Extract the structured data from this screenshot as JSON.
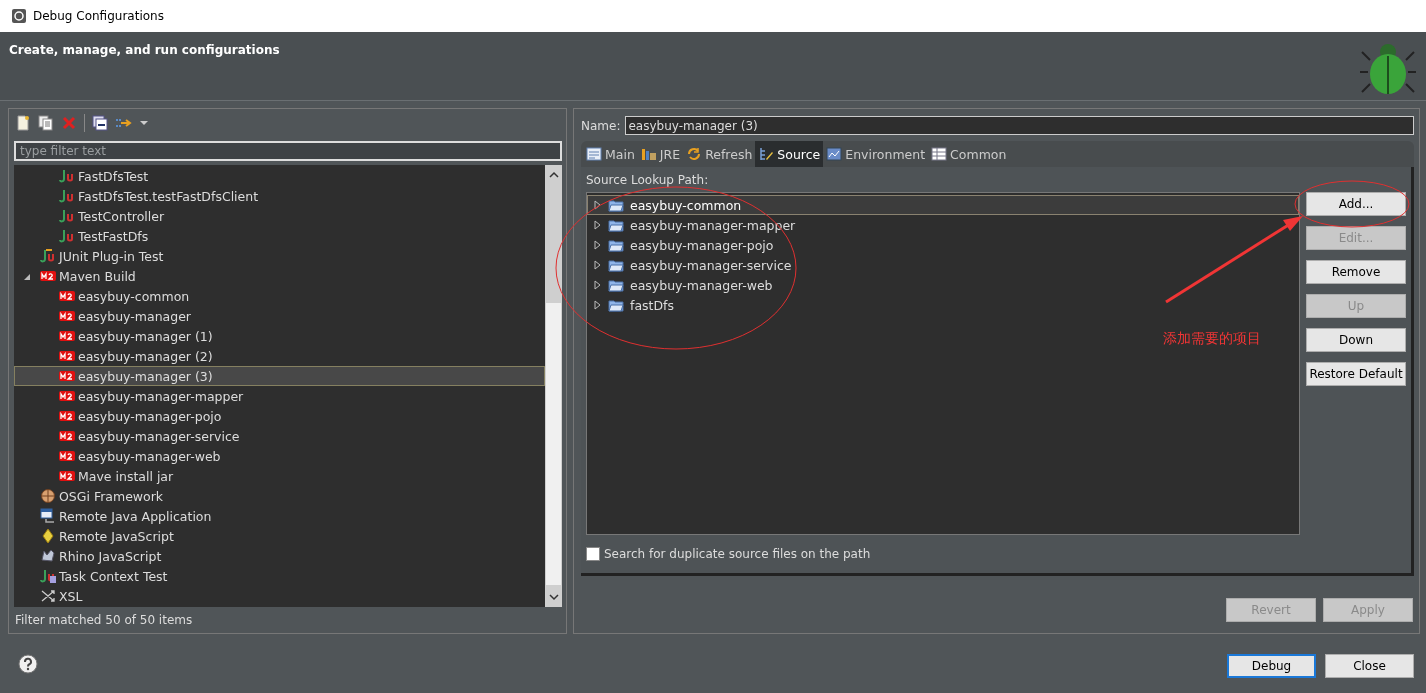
{
  "window": {
    "title": "Debug Configurations"
  },
  "header": {
    "title": "Create, manage, and run configurations"
  },
  "sidebar": {
    "filter": {
      "placeholder": "type filter text"
    },
    "tree": {
      "continued_children": [
        {
          "label": "FastDfsTest",
          "kind": "junit",
          "selected": false
        },
        {
          "label": "FastDfsTest.testFastDfsClient",
          "kind": "junit",
          "selected": false
        },
        {
          "label": "TestController",
          "kind": "junit",
          "selected": false
        },
        {
          "label": "TestFastDfs",
          "kind": "junit",
          "selected": false
        }
      ],
      "items": [
        {
          "label": "JUnit Plug-in Test",
          "kind": "junit-plugin",
          "selected": false
        },
        {
          "label": "Maven Build",
          "kind": "maven",
          "selected": false,
          "expanded": true,
          "children": [
            {
              "label": "easybuy-common",
              "kind": "maven",
              "selected": false
            },
            {
              "label": "easybuy-manager",
              "kind": "maven",
              "selected": false
            },
            {
              "label": "easybuy-manager (1)",
              "kind": "maven",
              "selected": false
            },
            {
              "label": "easybuy-manager (2)",
              "kind": "maven",
              "selected": false
            },
            {
              "label": "easybuy-manager (3)",
              "kind": "maven",
              "selected": true
            },
            {
              "label": "easybuy-manager-mapper",
              "kind": "maven",
              "selected": false
            },
            {
              "label": "easybuy-manager-pojo",
              "kind": "maven",
              "selected": false
            },
            {
              "label": "easybuy-manager-service",
              "kind": "maven",
              "selected": false
            },
            {
              "label": "easybuy-manager-web",
              "kind": "maven",
              "selected": false
            },
            {
              "label": "Mave install jar",
              "kind": "maven",
              "selected": false
            }
          ]
        },
        {
          "label": "OSGi Framework",
          "kind": "osgi",
          "selected": false
        },
        {
          "label": "Remote Java Application",
          "kind": "remote-java",
          "selected": false
        },
        {
          "label": "Remote JavaScript",
          "kind": "remote-js",
          "selected": false
        },
        {
          "label": "Rhino JavaScript",
          "kind": "rhino",
          "selected": false
        },
        {
          "label": "Task Context Test",
          "kind": "task-context",
          "selected": false
        },
        {
          "label": "XSL",
          "kind": "xsl",
          "selected": false
        }
      ]
    },
    "status": "Filter matched 50 of 50 items"
  },
  "editor": {
    "name_label": "Name:",
    "name": "easybuy-manager (3)",
    "tabs": [
      {
        "label": "Main",
        "kind": "main",
        "selected": false
      },
      {
        "label": "JRE",
        "kind": "jre",
        "selected": false
      },
      {
        "label": "Refresh",
        "kind": "refresh",
        "selected": false
      },
      {
        "label": "Source",
        "kind": "source",
        "selected": true
      },
      {
        "label": "Environment",
        "kind": "environment",
        "selected": false
      },
      {
        "label": "Common",
        "kind": "common",
        "selected": false
      }
    ],
    "source": {
      "label": "Source Lookup Path:",
      "items": [
        {
          "label": "easybuy-common",
          "selected": true,
          "expanded": false
        },
        {
          "label": "easybuy-manager-mapper",
          "selected": false,
          "expanded": false
        },
        {
          "label": "easybuy-manager-pojo",
          "selected": false,
          "expanded": false
        },
        {
          "label": "easybuy-manager-service",
          "selected": false,
          "expanded": false
        },
        {
          "label": "easybuy-manager-web",
          "selected": false,
          "expanded": false
        },
        {
          "label": "fastDfs",
          "selected": false,
          "expanded": false
        }
      ],
      "buttons": [
        {
          "label": "Add...",
          "disabled": false
        },
        {
          "label": "Edit...",
          "disabled": true
        },
        {
          "label": "Remove",
          "disabled": false
        },
        {
          "label": "Up",
          "disabled": true
        },
        {
          "label": "Down",
          "disabled": false
        },
        {
          "label": "Restore Default",
          "disabled": false
        }
      ],
      "duplicate_check": {
        "label": "Search for duplicate source files on the path",
        "checked": false
      }
    },
    "actions": [
      {
        "label": "Revert",
        "disabled": true
      },
      {
        "label": "Apply",
        "disabled": true
      }
    ]
  },
  "footer": {
    "buttons": [
      {
        "label": "Debug",
        "default": true
      },
      {
        "label": "Close",
        "default": false
      }
    ]
  },
  "annotation": {
    "text": "添加需要的项目"
  }
}
